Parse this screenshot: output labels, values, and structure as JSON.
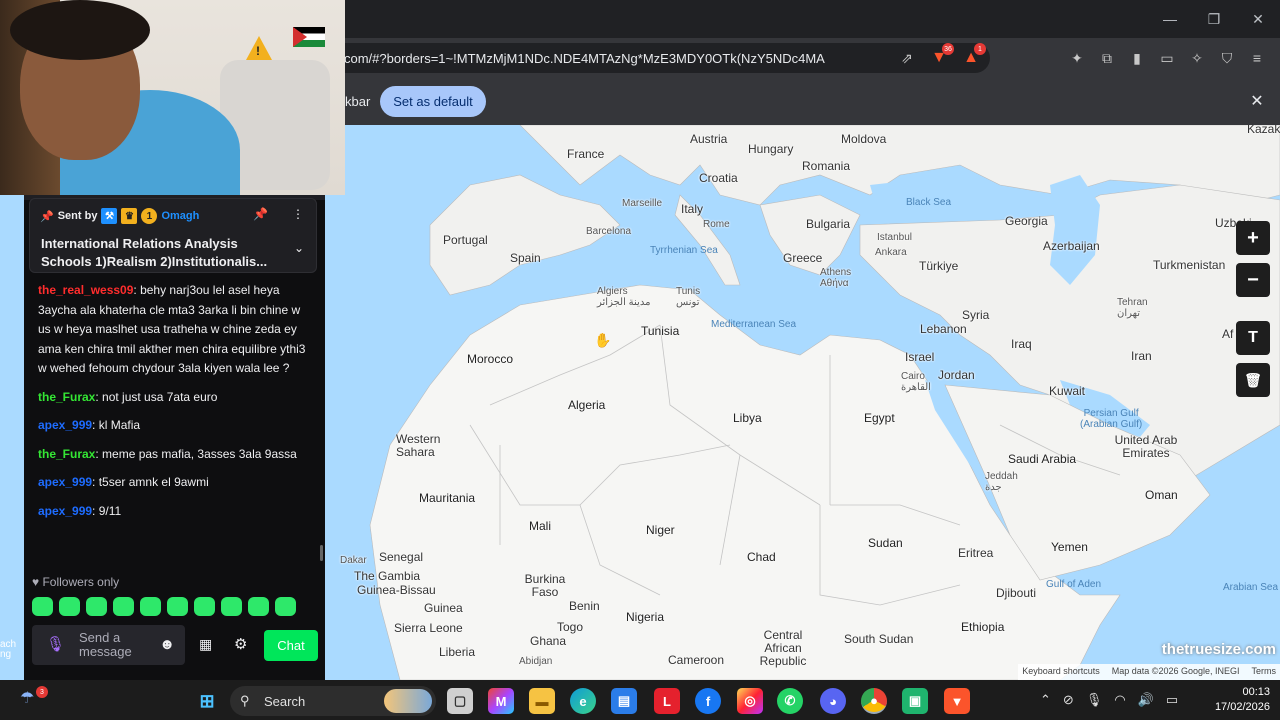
{
  "browser": {
    "url": "com/#?borders=1~!MTMzMjM1NDc.NDE4MTAzNg*MzE3MDY0OTk(NzY5NDc4MA",
    "infobar_text": "kbar",
    "set_default_label": "Set as default",
    "brave_badge": "36",
    "alert_badge": "1"
  },
  "map": {
    "countries": [
      {
        "name": "Austria"
      },
      {
        "name": "Moldova"
      },
      {
        "name": "France"
      },
      {
        "name": "Hungary"
      },
      {
        "name": "Romania"
      },
      {
        "name": "Croatia"
      },
      {
        "name": "Italy"
      },
      {
        "name": "Bulgaria"
      },
      {
        "name": "Portugal"
      },
      {
        "name": "Spain"
      },
      {
        "name": "Greece"
      },
      {
        "name": "Türkiye"
      },
      {
        "name": "Georgia"
      },
      {
        "name": "Azerbaijan"
      },
      {
        "name": "Turkmenistan"
      },
      {
        "name": "Uzbeki"
      },
      {
        "name": "Kazak"
      },
      {
        "name": "Syria"
      },
      {
        "name": "Lebanon"
      },
      {
        "name": "Iraq"
      },
      {
        "name": "Iran"
      },
      {
        "name": "Israel"
      },
      {
        "name": "Jordan"
      },
      {
        "name": "Kuwait"
      },
      {
        "name": "Tunisia"
      },
      {
        "name": "Morocco"
      },
      {
        "name": "Algeria"
      },
      {
        "name": "Libya"
      },
      {
        "name": "Egypt"
      },
      {
        "name": "Western Sahara"
      },
      {
        "name": "Saudi Arabia"
      },
      {
        "name": "United Arab Emirates"
      },
      {
        "name": "Mauritania"
      },
      {
        "name": "Mali"
      },
      {
        "name": "Niger"
      },
      {
        "name": "Chad"
      },
      {
        "name": "Sudan"
      },
      {
        "name": "Eritrea"
      },
      {
        "name": "Yemen"
      },
      {
        "name": "Oman"
      },
      {
        "name": "Senegal"
      },
      {
        "name": "The Gambia"
      },
      {
        "name": "Guinea-Bissau"
      },
      {
        "name": "Burkina Faso"
      },
      {
        "name": "Guinea"
      },
      {
        "name": "Benin"
      },
      {
        "name": "Sierra Leone"
      },
      {
        "name": "Togo"
      },
      {
        "name": "Nigeria"
      },
      {
        "name": "Ghana"
      },
      {
        "name": "Liberia"
      },
      {
        "name": "Djibouti"
      },
      {
        "name": "Ethiopia"
      },
      {
        "name": "Central African Republic"
      },
      {
        "name": "South Sudan"
      },
      {
        "name": "Cameroon"
      },
      {
        "name": "Af"
      }
    ],
    "cities": [
      {
        "name": "Marseille"
      },
      {
        "name": "Rome"
      },
      {
        "name": "Barcelona"
      },
      {
        "name": "Istanbul"
      },
      {
        "name": "Ankara"
      },
      {
        "name": "Athens\nΑθήνα"
      },
      {
        "name": "Algiers\nمدينة الجزائر"
      },
      {
        "name": "Tunis\nتونس"
      },
      {
        "name": "Tehran\nتهران"
      },
      {
        "name": "Cairo\nالقاهرة"
      },
      {
        "name": "Jeddah\nجدة"
      },
      {
        "name": "Dakar"
      },
      {
        "name": "Abidjan"
      }
    ],
    "seas": [
      {
        "name": "Black Sea"
      },
      {
        "name": "Tyrrhenian Sea"
      },
      {
        "name": "Mediterranean Sea"
      },
      {
        "name": "Persian Gulf\n(Arabian Gulf)"
      },
      {
        "name": "Gulf of Aden"
      },
      {
        "name": "Arabian Sea"
      }
    ],
    "watermark": "thetruesize.com",
    "footer": [
      "Keyboard shortcuts",
      "Map data ©2026 Google, INEGI",
      "Terms"
    ],
    "tools": {
      "zoom_in": "+",
      "zoom_out": "−",
      "text": "T",
      "trash": "🗑"
    },
    "left_edge_label": "ach\nng"
  },
  "chat": {
    "pinned": {
      "sent_by_label": "Sent by",
      "sub_months": "1",
      "user": "Omagh",
      "message": "International Relations Analysis Schools 1)Realism 2)Institutionalis..."
    },
    "messages": [
      {
        "user": "the_real_wess09",
        "color": "#ff2d2d",
        "text": "behy narj3ou lel asel heya 3aycha ala khaterha cle mta3 3arka li bin chine w us w heya maslhet usa tratheha w chine zeda ey ama ken chira tmil akther men chira equilibre ythi3 w wehed fehoum chydour 3ala kiyen wala lee ?"
      },
      {
        "user": "the_Furax",
        "color": "#34e634",
        "text": "not just usa 7ata euro"
      },
      {
        "user": "apex_999",
        "color": "#1e6cff",
        "text": "kl Mafia"
      },
      {
        "user": "the_Furax",
        "color": "#34e634",
        "text": "meme pas mafia, 3asses 3ala 9assa"
      },
      {
        "user": "apex_999",
        "color": "#1e6cff",
        "text": "t5ser amnk el 9awmi"
      },
      {
        "user": "apex_999",
        "color": "#1e6cff",
        "text": "9/11"
      }
    ],
    "followers_only": "Followers only",
    "input_placeholder": "Send a message",
    "chat_button": "Chat"
  },
  "taskbar": {
    "search_label": "Search",
    "weather_badge": "3",
    "time": "00:13",
    "date": "17/02/2026"
  }
}
